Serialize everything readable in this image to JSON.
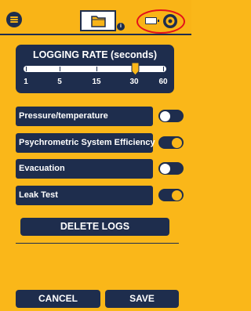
{
  "header": {
    "menu_icon": "hamburger-menu-icon",
    "folder_icon": "folder-icon",
    "info_badge": "i",
    "battery_icon": "battery-icon",
    "settings_icon": "gear-icon",
    "highlight_color": "#e3121a"
  },
  "logging_rate": {
    "title": "LOGGING RATE (seconds)",
    "ticks": [
      "1",
      "5",
      "15",
      "30",
      "60"
    ],
    "selected": "30"
  },
  "logs": [
    {
      "label": "Pressure/temperature",
      "enabled": false
    },
    {
      "label": "Psychrometric System Efficiency",
      "enabled": true
    },
    {
      "label": "Evacuation",
      "enabled": false
    },
    {
      "label": "Leak Test",
      "enabled": true
    }
  ],
  "actions": {
    "delete_label": "DELETE LOGS",
    "cancel_label": "CANCEL",
    "save_label": "SAVE"
  },
  "colors": {
    "background": "#fab719",
    "navy": "#1e2d4d",
    "white": "#ffffff"
  }
}
